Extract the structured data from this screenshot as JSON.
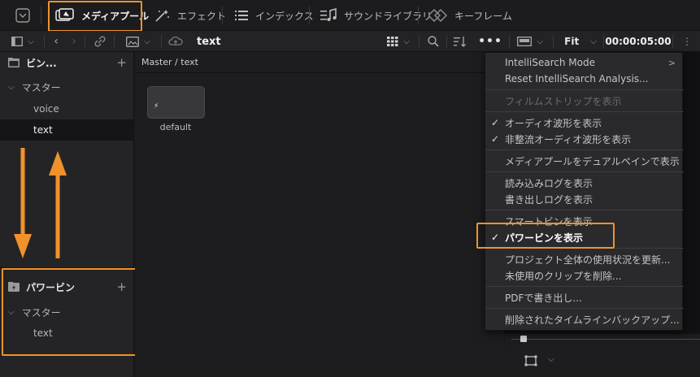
{
  "top_tabs": [
    {
      "label": "メディアプール",
      "icon": "media-pool-icon"
    },
    {
      "label": "エフェクト",
      "icon": "effects-icon"
    },
    {
      "label": "インデックス",
      "icon": "index-icon"
    },
    {
      "label": "サウンドライブラリ",
      "icon": "sound-library-icon"
    },
    {
      "label": "キーフレーム",
      "icon": "keyframes-icon"
    }
  ],
  "toolbar": {
    "bin_name": "text",
    "zoom_label": "Fit",
    "timecode": "00:00:05:00"
  },
  "bins_panel": {
    "header": "ビン...",
    "plus": "+",
    "master": "マスター",
    "items": [
      "voice",
      "text"
    ]
  },
  "power_bins": {
    "header": "パワービン",
    "plus": "+",
    "master": "マスター",
    "items": [
      "text"
    ]
  },
  "content": {
    "breadcrumb": "Master / text",
    "clip_name": "default"
  },
  "menu": {
    "items": [
      {
        "label": "IntelliSearch Mode",
        "submenu": ">"
      },
      {
        "label": "Reset IntelliSearch Analysis..."
      },
      {
        "label": "フィルムストリップを表示"
      },
      {
        "label": "オーディオ波形を表示",
        "check": "✓"
      },
      {
        "label": "非整流オーディオ波形を表示",
        "check": "✓"
      },
      {
        "label": "メディアプールをデュアルペインで表示"
      },
      {
        "label": "読み込みログを表示"
      },
      {
        "label": "書き出しログを表示"
      },
      {
        "label": "スマートビンを表示"
      },
      {
        "label": "パワービンを表示",
        "check": "✓"
      },
      {
        "label": "プロジェクト全体の使用状況を更新..."
      },
      {
        "label": "未使用のクリップを削除..."
      },
      {
        "label": "PDFで書き出し..."
      },
      {
        "label": "削除されたタイムラインバックアップ..."
      }
    ]
  },
  "colors": {
    "highlight": "#f0922b",
    "background": "#1a1a1c"
  }
}
